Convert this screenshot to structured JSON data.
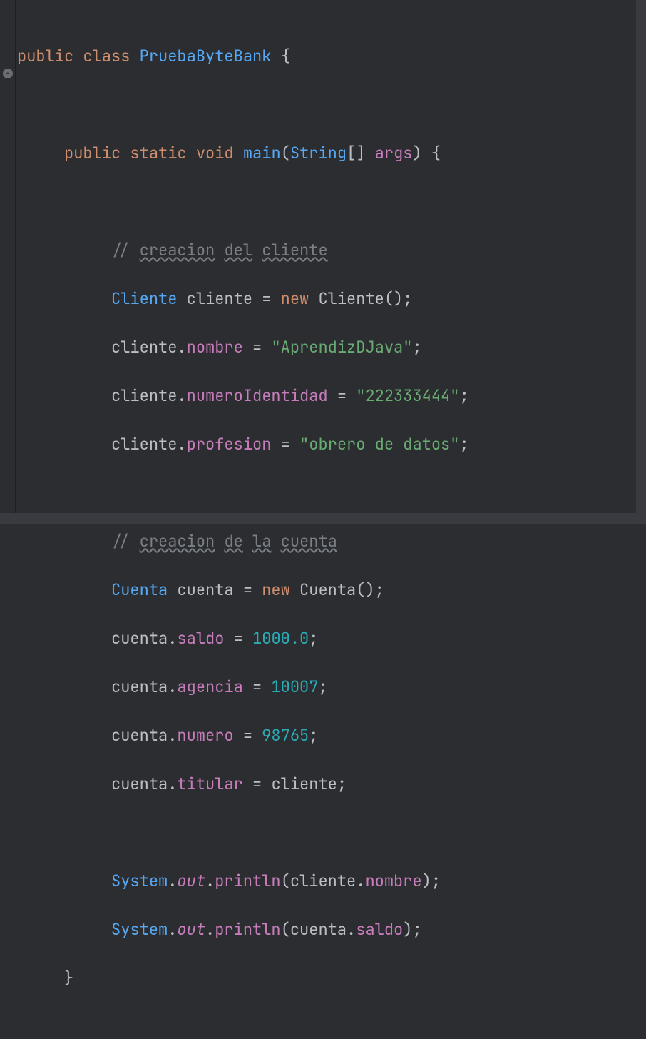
{
  "code": {
    "line1": {
      "kw1": "public",
      "kw2": "class",
      "classname": "PruebaByteBank",
      "brace": "{"
    },
    "line3": {
      "kw1": "public",
      "kw2": "static",
      "kw3": "void",
      "method": "main",
      "paren1": "(",
      "type": "String",
      "brackets": "[]",
      "param": "args",
      "paren2": ")",
      "brace": "{"
    },
    "line5": {
      "slashes": "// ",
      "w1": "creacion",
      "sp1": " ",
      "w2": "del",
      "sp2": " ",
      "w3": "cliente"
    },
    "line6": {
      "type": "Cliente",
      "var": "cliente",
      "eq": " = ",
      "kw": "new",
      "ctor": "Cliente",
      "parens": "();"
    },
    "line7": {
      "var": "cliente",
      "dot": ".",
      "field": "nombre",
      "eq": " = ",
      "str": "\"AprendizDJava\"",
      "semi": ";"
    },
    "line8": {
      "var": "cliente",
      "dot": ".",
      "field": "numeroIdentidad",
      "eq": " = ",
      "str": "\"222333444\"",
      "semi": ";"
    },
    "line9": {
      "var": "cliente",
      "dot": ".",
      "field": "profesion",
      "eq": " = ",
      "str": "\"obrero de datos\"",
      "semi": ";"
    },
    "line11": {
      "slashes": "// ",
      "w1": "creacion",
      "sp1": " ",
      "w2": "de",
      "sp2": " ",
      "w3": "la",
      "sp3": " ",
      "w4": "cuenta"
    },
    "line12": {
      "type": "Cuenta",
      "var": "cuenta",
      "eq": " = ",
      "kw": "new",
      "ctor": "Cuenta",
      "parens": "();"
    },
    "line13": {
      "var": "cuenta",
      "dot": ".",
      "field": "saldo",
      "eq": " = ",
      "num": "1000.0",
      "semi": ";"
    },
    "line14": {
      "var": "cuenta",
      "dot": ".",
      "field": "agencia",
      "eq": " = ",
      "num": "10007",
      "semi": ";"
    },
    "line15": {
      "var": "cuenta",
      "dot": ".",
      "field": "numero",
      "eq": " = ",
      "num": "98765",
      "semi": ";"
    },
    "line16": {
      "var": "cuenta",
      "dot": ".",
      "field": "titular",
      "eq": " = ",
      "val": "cliente",
      "semi": ";"
    },
    "line18": {
      "cls": "System",
      "dot1": ".",
      "out": "out",
      "dot2": ".",
      "method": "println",
      "paren1": "(",
      "arg1": "cliente",
      "dot3": ".",
      "field": "nombre",
      "paren2": ");"
    },
    "line19": {
      "cls": "System",
      "dot1": ".",
      "out": "out",
      "dot2": ".",
      "method": "println",
      "paren1": "(",
      "arg1": "cuenta",
      "dot3": ".",
      "field": "saldo",
      "paren2": ");"
    },
    "line20": {
      "brace": "}"
    }
  }
}
